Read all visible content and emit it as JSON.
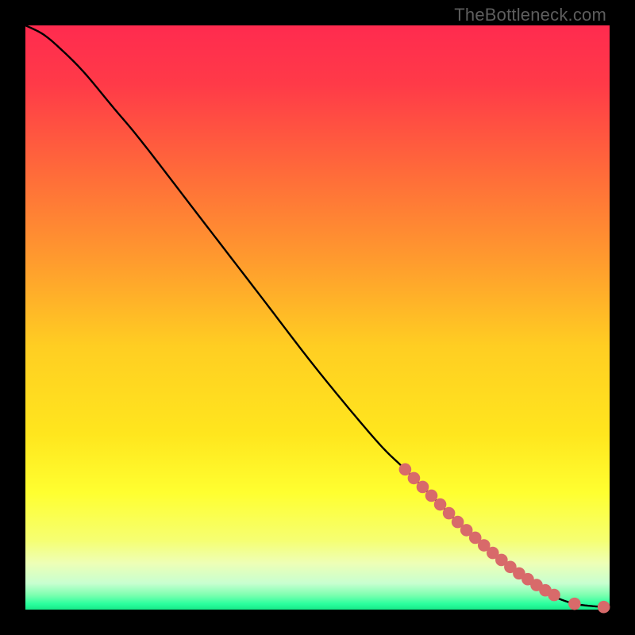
{
  "watermark": "TheBottleneck.com",
  "colors": {
    "curve": "#000000",
    "points": "#d86a6a",
    "black": "#000000",
    "gradient_stops": [
      {
        "offset": 0.0,
        "color": "#ff2b4f"
      },
      {
        "offset": 0.1,
        "color": "#ff3a48"
      },
      {
        "offset": 0.25,
        "color": "#ff6a3a"
      },
      {
        "offset": 0.4,
        "color": "#ff9a2e"
      },
      {
        "offset": 0.55,
        "color": "#ffce22"
      },
      {
        "offset": 0.7,
        "color": "#ffe61e"
      },
      {
        "offset": 0.8,
        "color": "#ffff30"
      },
      {
        "offset": 0.88,
        "color": "#f6ff70"
      },
      {
        "offset": 0.92,
        "color": "#eeffb5"
      },
      {
        "offset": 0.955,
        "color": "#c8ffd0"
      },
      {
        "offset": 0.975,
        "color": "#7dffb0"
      },
      {
        "offset": 0.99,
        "color": "#2bff9e"
      },
      {
        "offset": 1.0,
        "color": "#17e989"
      }
    ]
  },
  "chart_data": {
    "type": "line",
    "title": "",
    "xlabel": "",
    "ylabel": "",
    "xlim": [
      0,
      100
    ],
    "ylim": [
      0,
      100
    ],
    "series": [
      {
        "name": "main-curve",
        "x": [
          0,
          3,
          6,
          10,
          15,
          20,
          30,
          40,
          50,
          60,
          65,
          70,
          75,
          80,
          85,
          88,
          91,
          94,
          97,
          100
        ],
        "y": [
          100,
          98.5,
          96,
          92,
          86,
          80,
          67,
          54,
          41,
          29,
          24,
          19,
          14,
          9.5,
          5.5,
          3.5,
          2,
          1,
          0.6,
          0.4
        ]
      }
    ],
    "points": {
      "name": "highlighted-segment",
      "x": [
        65,
        66.5,
        68,
        69.5,
        71,
        72.5,
        74,
        75.5,
        77,
        78.5,
        80,
        81.5,
        83,
        84.5,
        86,
        87.5,
        89,
        90.5,
        94,
        99
      ],
      "y": [
        24,
        22.5,
        21,
        19.5,
        18,
        16.5,
        15,
        13.6,
        12.3,
        11,
        9.7,
        8.5,
        7.3,
        6.2,
        5.2,
        4.2,
        3.3,
        2.5,
        1.0,
        0.45
      ]
    }
  }
}
